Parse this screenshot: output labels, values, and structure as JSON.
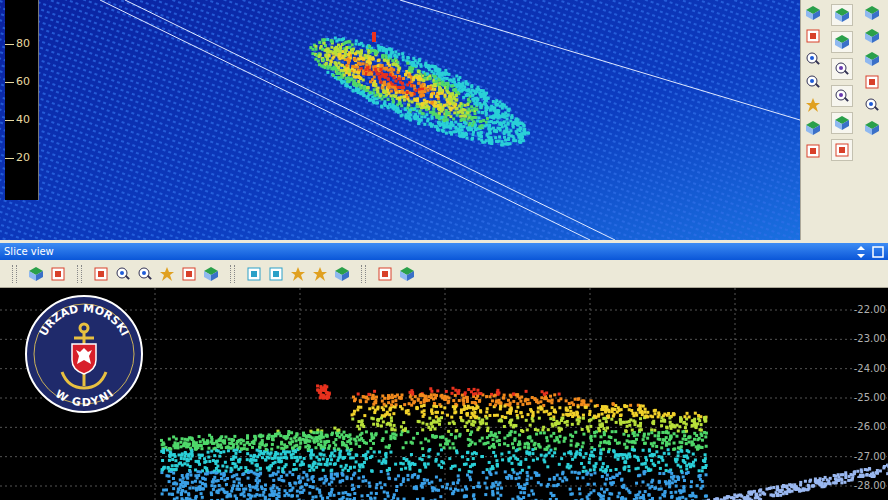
{
  "view3d": {
    "ruler_ticks": [
      "80",
      "60",
      "40",
      "20"
    ]
  },
  "slice_view": {
    "title": "Slice view",
    "depth_labels": [
      "-22.00",
      "-23.00",
      "-24.00",
      "-25.00",
      "-26.00",
      "-27.00",
      "-28.00"
    ]
  },
  "logo": {
    "top_text": "URZAD MORSKI",
    "bottom_text": "W GDYNI"
  }
}
